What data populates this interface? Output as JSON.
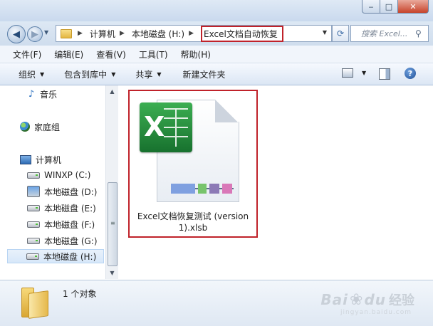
{
  "window": {
    "minimize_glyph": "‒",
    "maximize_glyph": "□",
    "close_glyph": "✕"
  },
  "address_bar": {
    "breadcrumbs": [
      "计算机",
      "本地磁盘 (H:)",
      "Excel文档自动恢复"
    ],
    "highlight_color": "#c0222a"
  },
  "search": {
    "placeholder": "搜索 Excel..."
  },
  "menubar": {
    "items": [
      "文件(F)",
      "编辑(E)",
      "查看(V)",
      "工具(T)",
      "帮助(H)"
    ]
  },
  "toolbar": {
    "organize": "组织",
    "include_in_library": "包含到库中",
    "share": "共享",
    "new_folder": "新建文件夹",
    "help_glyph": "?"
  },
  "navpane": {
    "music": "音乐",
    "homegroup": "家庭组",
    "computer": "计算机",
    "drives": [
      {
        "label": "WINXP (C:)"
      },
      {
        "label": "本地磁盘 (D:)"
      },
      {
        "label": "本地磁盘 (E:)"
      },
      {
        "label": "本地磁盘 (F:)"
      },
      {
        "label": "本地磁盘 (G:)"
      },
      {
        "label": "本地磁盘 (H:)",
        "selected": true
      }
    ]
  },
  "content": {
    "file": {
      "name": "Excel文档恢复测试 (version 1).xlsb",
      "icon": "excel-binary-workbook-icon"
    }
  },
  "details": {
    "count_text": "1 个对象"
  },
  "watermark": {
    "brand": "Bai",
    "brand2": "du",
    "cn": "经验",
    "url": "jingyan.baidu.com"
  }
}
